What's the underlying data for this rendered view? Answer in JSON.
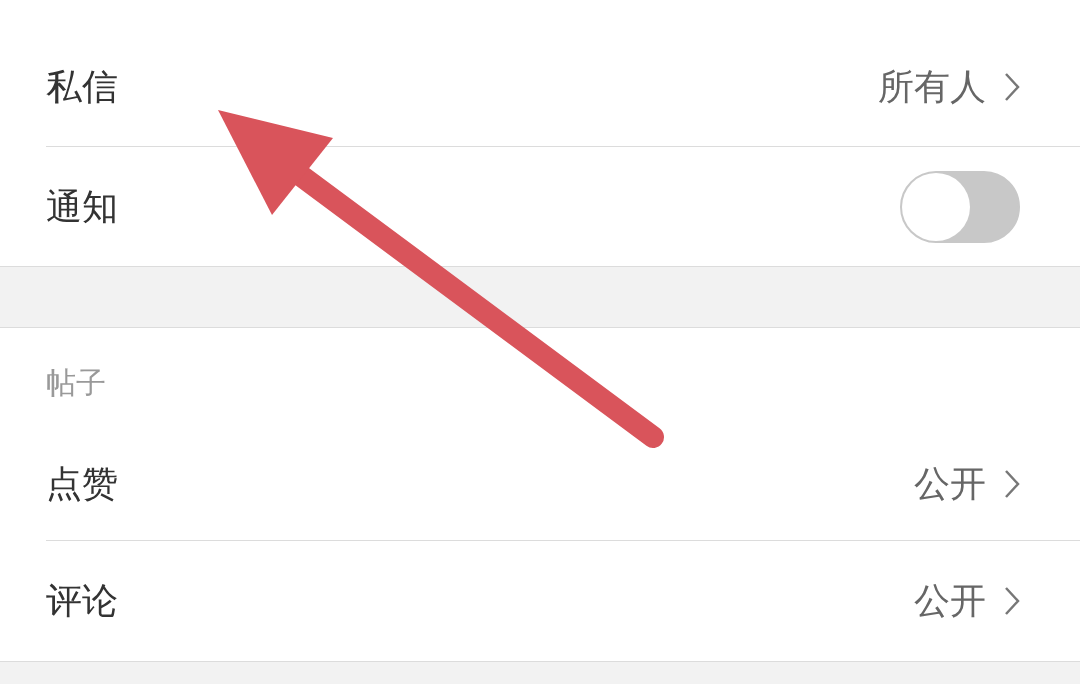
{
  "sections": [
    {
      "rows": [
        {
          "kind": "link",
          "label": "私信",
          "value": "所有人"
        },
        {
          "kind": "toggle",
          "label": "通知",
          "on": false
        }
      ]
    },
    {
      "title": "帖子",
      "rows": [
        {
          "kind": "link",
          "label": "点赞",
          "value": "公开"
        },
        {
          "kind": "link",
          "label": "评论",
          "value": "公开"
        }
      ]
    }
  ]
}
